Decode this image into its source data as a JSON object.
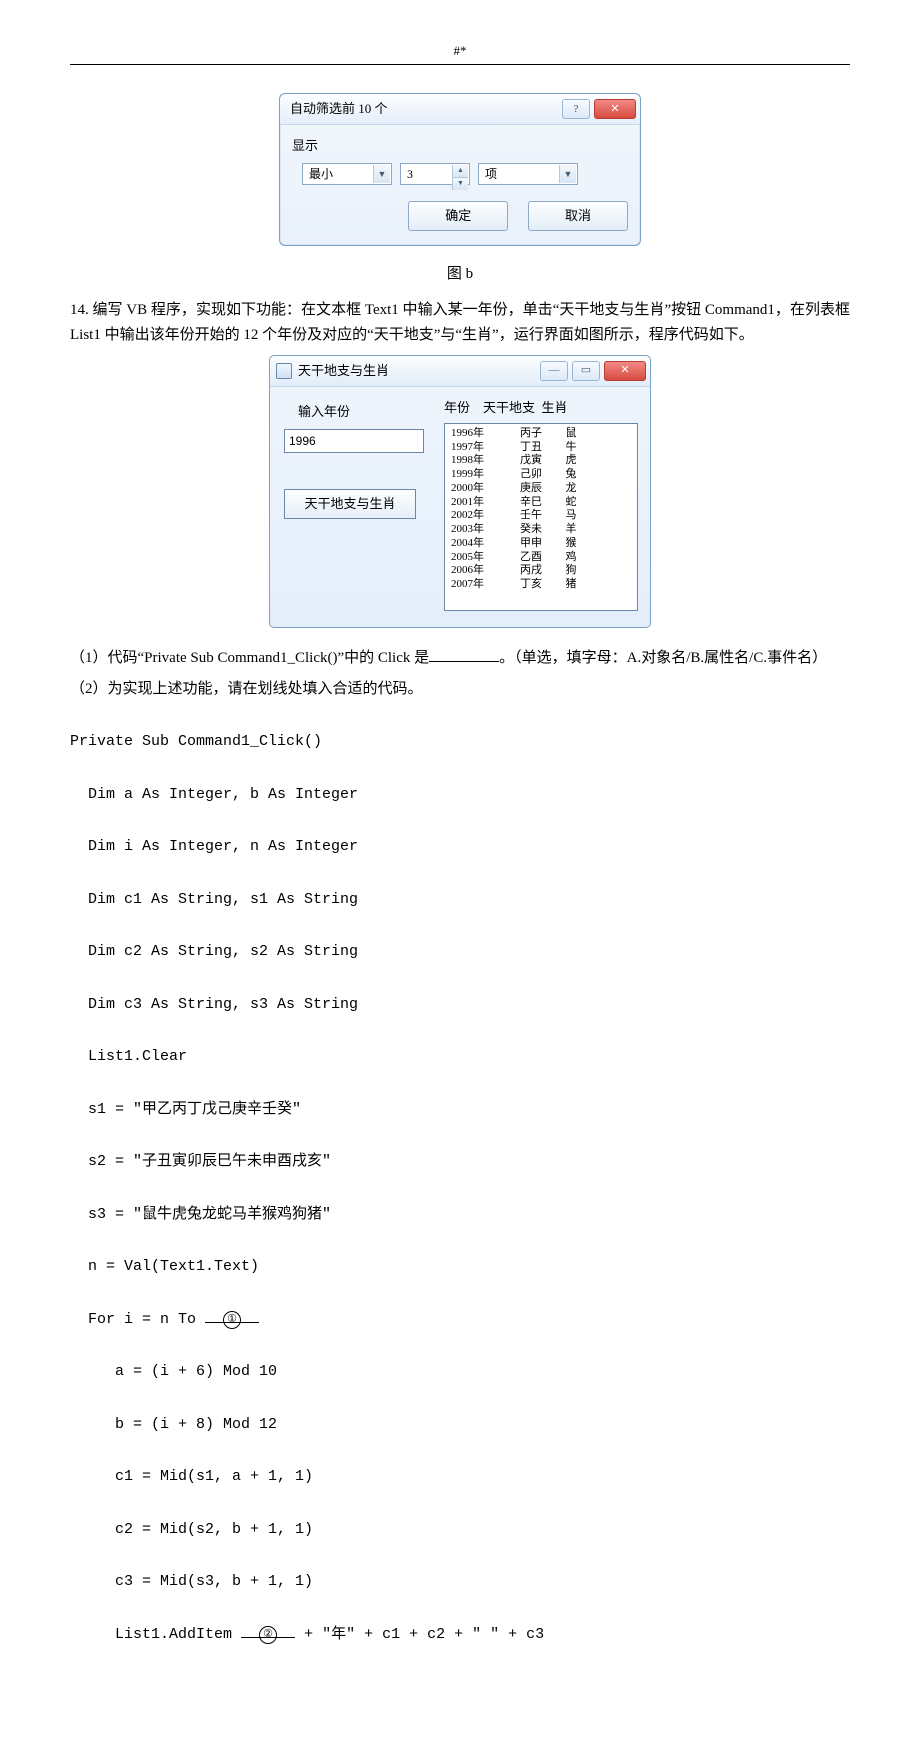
{
  "header_mark": "#*",
  "dialog1": {
    "title": "自动筛选前 10 个",
    "help_glyph": "?",
    "close_glyph": "✕",
    "group_label": "显示",
    "combo_value": "最小",
    "spin_value": "3",
    "combo2_value": "项",
    "ok": "确定",
    "cancel": "取消"
  },
  "fig_b": "图 b",
  "question_intro": "14. 编写 VB 程序，实现如下功能：在文本框 Text1 中输入某一年份，单击“天干地支与生肖”按钮 Command1，在列表框 List1 中输出该年份开始的 12 个年份及对应的“天干地支”与“生肖”，运行界面如图所示，程序代码如下。",
  "dialog2": {
    "title": "天干地支与生肖",
    "min_glyph": "—",
    "max_glyph": "▭",
    "close_glyph": "✕",
    "input_label": "输入年份",
    "text1_value": "1996",
    "button_label": "天干地支与生肖",
    "list_header": "年份    天干地支  生肖",
    "rows": [
      {
        "y": "1996年",
        "g": "丙子",
        "z": "鼠"
      },
      {
        "y": "1997年",
        "g": "丁丑",
        "z": "牛"
      },
      {
        "y": "1998年",
        "g": "戊寅",
        "z": "虎"
      },
      {
        "y": "1999年",
        "g": "己卯",
        "z": "兔"
      },
      {
        "y": "2000年",
        "g": "庚辰",
        "z": "龙"
      },
      {
        "y": "2001年",
        "g": "辛巳",
        "z": "蛇"
      },
      {
        "y": "2002年",
        "g": "壬午",
        "z": "马"
      },
      {
        "y": "2003年",
        "g": "癸未",
        "z": "羊"
      },
      {
        "y": "2004年",
        "g": "甲申",
        "z": "猴"
      },
      {
        "y": "2005年",
        "g": "乙酉",
        "z": "鸡"
      },
      {
        "y": "2006年",
        "g": "丙戌",
        "z": "狗"
      },
      {
        "y": "2007年",
        "g": "丁亥",
        "z": "猪"
      }
    ]
  },
  "q1_a": "（1）代码“Private Sub Command1_Click()”中的 Click 是",
  "q1_b": "。（单选，填字母：A.对象名/B.属性名/C.事件名）",
  "q2": "（2）为实现上述功能，请在划线处填入合适的代码。",
  "code": {
    "l1": "Private Sub Command1_Click()",
    "l2": "Dim a As Integer, b As Integer",
    "l3": "Dim i As Integer, n As Integer",
    "l4": "Dim c1 As String, s1 As String",
    "l5": "Dim c2 As String, s2 As String",
    "l6": "Dim c3 As String, s3 As String",
    "l7": "List1.Clear",
    "l8": "s1 = \"甲乙丙丁戊己庚辛壬癸\"",
    "l9": "s2 = \"子丑寅卯辰巳午未申酉戌亥\"",
    "l10": "s3 = \"鼠牛虎兔龙蛇马羊猴鸡狗猪\"",
    "l11": "n = Val(Text1.Text)",
    "l12a": "For i = n To ",
    "l13": "a = (i + 6) Mod 10",
    "l14": "b = (i + 8) Mod 12",
    "l15": "c1 = Mid(s1, a + 1, 1)",
    "l16": "c2 = Mid(s2, b + 1, 1)",
    "l17": "c3 = Mid(s3, b + 1, 1)",
    "l18a": "List1.AddItem ",
    "l18b": " + \"年\" + c1 + c2 + \" \" + c3"
  },
  "circle1": "①",
  "circle2": "②"
}
